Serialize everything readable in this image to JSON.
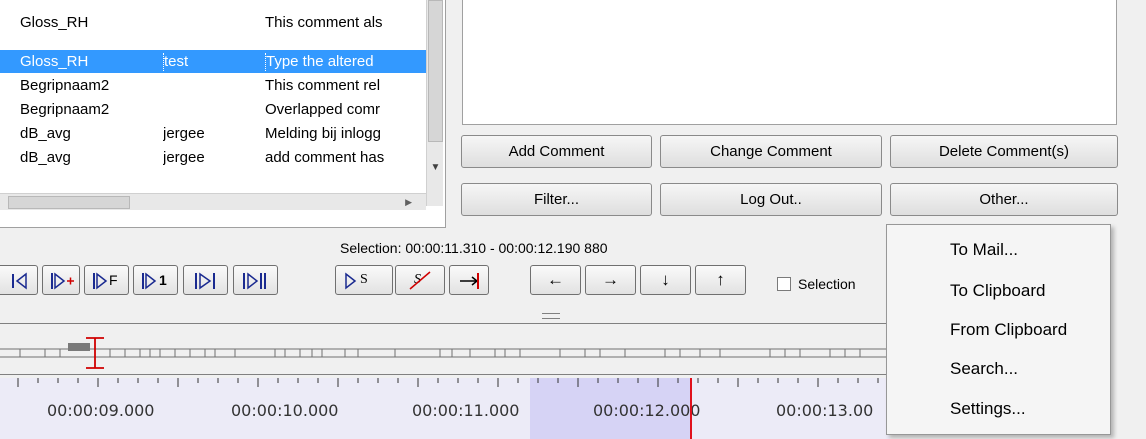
{
  "comments_table": {
    "rows": [
      {
        "tier": "Gloss_RH",
        "annotator": "",
        "comment": "This comment als",
        "selected": false
      },
      {
        "tier": "Gloss_RH",
        "annotator": "test",
        "comment": "Type the altered",
        "selected": true
      },
      {
        "tier": "Begripnaam2",
        "annotator": "",
        "comment": "This comment rel",
        "selected": false
      },
      {
        "tier": "Begripnaam2",
        "annotator": "",
        "comment": "Overlapped comr",
        "selected": false
      },
      {
        "tier": "dB_avg",
        "annotator": "jergee",
        "comment": "Melding bij inlogg",
        "selected": false
      },
      {
        "tier": "dB_avg",
        "annotator": "jergee",
        "comment": "add comment has",
        "selected": false
      }
    ]
  },
  "comment_buttons": {
    "add": "Add Comment",
    "change": "Change Comment",
    "delete": "Delete Comment(s)",
    "filter": "Filter...",
    "logout": "Log Out..",
    "other": "Other..."
  },
  "selection": {
    "text": "Selection: 00:00:11.310 - 00:00:12.190  880",
    "checkbox_label": "Selection"
  },
  "toolbar": {
    "buttons": [
      {
        "name": "go-to-begin",
        "label": ""
      },
      {
        "name": "prev-frame",
        "label": "F"
      },
      {
        "name": "prev-second",
        "label": "1"
      },
      {
        "name": "play-pause",
        "label": ""
      },
      {
        "name": "play-selection",
        "label": ""
      },
      {
        "name": "selection-start",
        "label": "S"
      },
      {
        "name": "clear-selection",
        "label": "S"
      },
      {
        "name": "selection-end",
        "label": ""
      },
      {
        "name": "arrow-left",
        "label": "←"
      },
      {
        "name": "arrow-right",
        "label": "→"
      },
      {
        "name": "arrow-down",
        "label": "↓"
      },
      {
        "name": "arrow-up",
        "label": "↑"
      }
    ]
  },
  "timeline": {
    "labels": [
      "00:00:09.000",
      "00:00:10.000",
      "00:00:11.000",
      "00:00:12.000",
      "00:00:13.00"
    ],
    "selection_start": "00:00:11.310",
    "selection_end": "00:00:12.190",
    "playhead": "00:00:12.190"
  },
  "other_menu": {
    "items": [
      "To Mail...",
      "To Clipboard",
      "From Clipboard",
      "Search...",
      "Settings..."
    ]
  },
  "colors": {
    "selection_highlight": "#3399ff",
    "playhead": "#e0101c",
    "timeline_selection": "#d6d3f5"
  }
}
